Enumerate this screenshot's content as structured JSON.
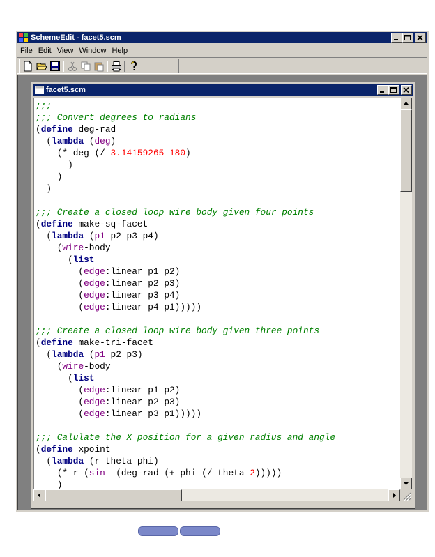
{
  "app": {
    "title": "SchemeEdit - facet5.scm",
    "menu": [
      "File",
      "Edit",
      "View",
      "Window",
      "Help"
    ],
    "toolbar_icons": [
      "new-file-icon",
      "open-folder-icon",
      "save-disk-icon",
      "cut-icon",
      "copy-icon",
      "paste-icon",
      "print-icon",
      "help-icon"
    ]
  },
  "document": {
    "title": "facet5.scm",
    "lines": [
      [
        {
          "t": ";;;",
          "c": "c"
        }
      ],
      [
        {
          "t": ";;; Convert degrees to radians",
          "c": "c"
        }
      ],
      [
        {
          "t": "(",
          "c": "b"
        },
        {
          "t": "define",
          "c": "k"
        },
        {
          "t": " deg-rad",
          "c": "b"
        }
      ],
      [
        {
          "t": "  (",
          "c": "b"
        },
        {
          "t": "lambda",
          "c": "k"
        },
        {
          "t": " (",
          "c": "b"
        },
        {
          "t": "deg",
          "c": "p"
        },
        {
          "t": ")",
          "c": "b"
        }
      ],
      [
        {
          "t": "    (* deg (/ ",
          "c": "b"
        },
        {
          "t": "3.14159265 180",
          "c": "n"
        },
        {
          "t": ")",
          "c": "b"
        }
      ],
      [
        {
          "t": "      )",
          "c": "b"
        }
      ],
      [
        {
          "t": "    )",
          "c": "b"
        }
      ],
      [
        {
          "t": "  )",
          "c": "b"
        }
      ],
      [
        {
          "t": "",
          "c": "b"
        }
      ],
      [
        {
          "t": ";;; Create a closed loop wire body given four points",
          "c": "c"
        }
      ],
      [
        {
          "t": "(",
          "c": "b"
        },
        {
          "t": "define",
          "c": "k"
        },
        {
          "t": " make-sq-facet",
          "c": "b"
        }
      ],
      [
        {
          "t": "  (",
          "c": "b"
        },
        {
          "t": "lambda",
          "c": "k"
        },
        {
          "t": " (",
          "c": "b"
        },
        {
          "t": "p1",
          "c": "p"
        },
        {
          "t": " p2 p3 p4)",
          "c": "b"
        }
      ],
      [
        {
          "t": "    (",
          "c": "b"
        },
        {
          "t": "wire",
          "c": "p"
        },
        {
          "t": "-body",
          "c": "b"
        }
      ],
      [
        {
          "t": "      (",
          "c": "b"
        },
        {
          "t": "list",
          "c": "k"
        }
      ],
      [
        {
          "t": "        (",
          "c": "b"
        },
        {
          "t": "edge",
          "c": "p"
        },
        {
          "t": ":linear p1 p2)",
          "c": "b"
        }
      ],
      [
        {
          "t": "        (",
          "c": "b"
        },
        {
          "t": "edge",
          "c": "p"
        },
        {
          "t": ":linear p2 p3)",
          "c": "b"
        }
      ],
      [
        {
          "t": "        (",
          "c": "b"
        },
        {
          "t": "edge",
          "c": "p"
        },
        {
          "t": ":linear p3 p4)",
          "c": "b"
        }
      ],
      [
        {
          "t": "        (",
          "c": "b"
        },
        {
          "t": "edge",
          "c": "p"
        },
        {
          "t": ":linear p4 p1)))))",
          "c": "b"
        }
      ],
      [
        {
          "t": "",
          "c": "b"
        }
      ],
      [
        {
          "t": ";;; Create a closed loop wire body given three points",
          "c": "c"
        }
      ],
      [
        {
          "t": "(",
          "c": "b"
        },
        {
          "t": "define",
          "c": "k"
        },
        {
          "t": " make-tri-facet",
          "c": "b"
        }
      ],
      [
        {
          "t": "  (",
          "c": "b"
        },
        {
          "t": "lambda",
          "c": "k"
        },
        {
          "t": " (",
          "c": "b"
        },
        {
          "t": "p1",
          "c": "p"
        },
        {
          "t": " p2 p3)",
          "c": "b"
        }
      ],
      [
        {
          "t": "    (",
          "c": "b"
        },
        {
          "t": "wire",
          "c": "p"
        },
        {
          "t": "-body",
          "c": "b"
        }
      ],
      [
        {
          "t": "      (",
          "c": "b"
        },
        {
          "t": "list",
          "c": "k"
        }
      ],
      [
        {
          "t": "        (",
          "c": "b"
        },
        {
          "t": "edge",
          "c": "p"
        },
        {
          "t": ":linear p1 p2)",
          "c": "b"
        }
      ],
      [
        {
          "t": "        (",
          "c": "b"
        },
        {
          "t": "edge",
          "c": "p"
        },
        {
          "t": ":linear p2 p3)",
          "c": "b"
        }
      ],
      [
        {
          "t": "        (",
          "c": "b"
        },
        {
          "t": "edge",
          "c": "p"
        },
        {
          "t": ":linear p3 p1)))))",
          "c": "b"
        }
      ],
      [
        {
          "t": "",
          "c": "b"
        }
      ],
      [
        {
          "t": ";;; Calulate the X position for a given radius and angle",
          "c": "c"
        }
      ],
      [
        {
          "t": "(",
          "c": "b"
        },
        {
          "t": "define",
          "c": "k"
        },
        {
          "t": " xpoint",
          "c": "b"
        }
      ],
      [
        {
          "t": "  (",
          "c": "b"
        },
        {
          "t": "lambda",
          "c": "k"
        },
        {
          "t": " (r theta phi)",
          "c": "b"
        }
      ],
      [
        {
          "t": "    (* r (",
          "c": "b"
        },
        {
          "t": "sin",
          "c": "p"
        },
        {
          "t": "  (deg-rad (+ phi (/ theta ",
          "c": "b"
        },
        {
          "t": "2",
          "c": "n"
        },
        {
          "t": ")))))",
          "c": "b"
        }
      ],
      [
        {
          "t": "    )",
          "c": "b"
        }
      ]
    ]
  },
  "colors": {
    "comment": "#008000",
    "keyword": "#000080",
    "builtin": "#800080",
    "number": "#ff0000",
    "titlebar": "#0a246a"
  }
}
